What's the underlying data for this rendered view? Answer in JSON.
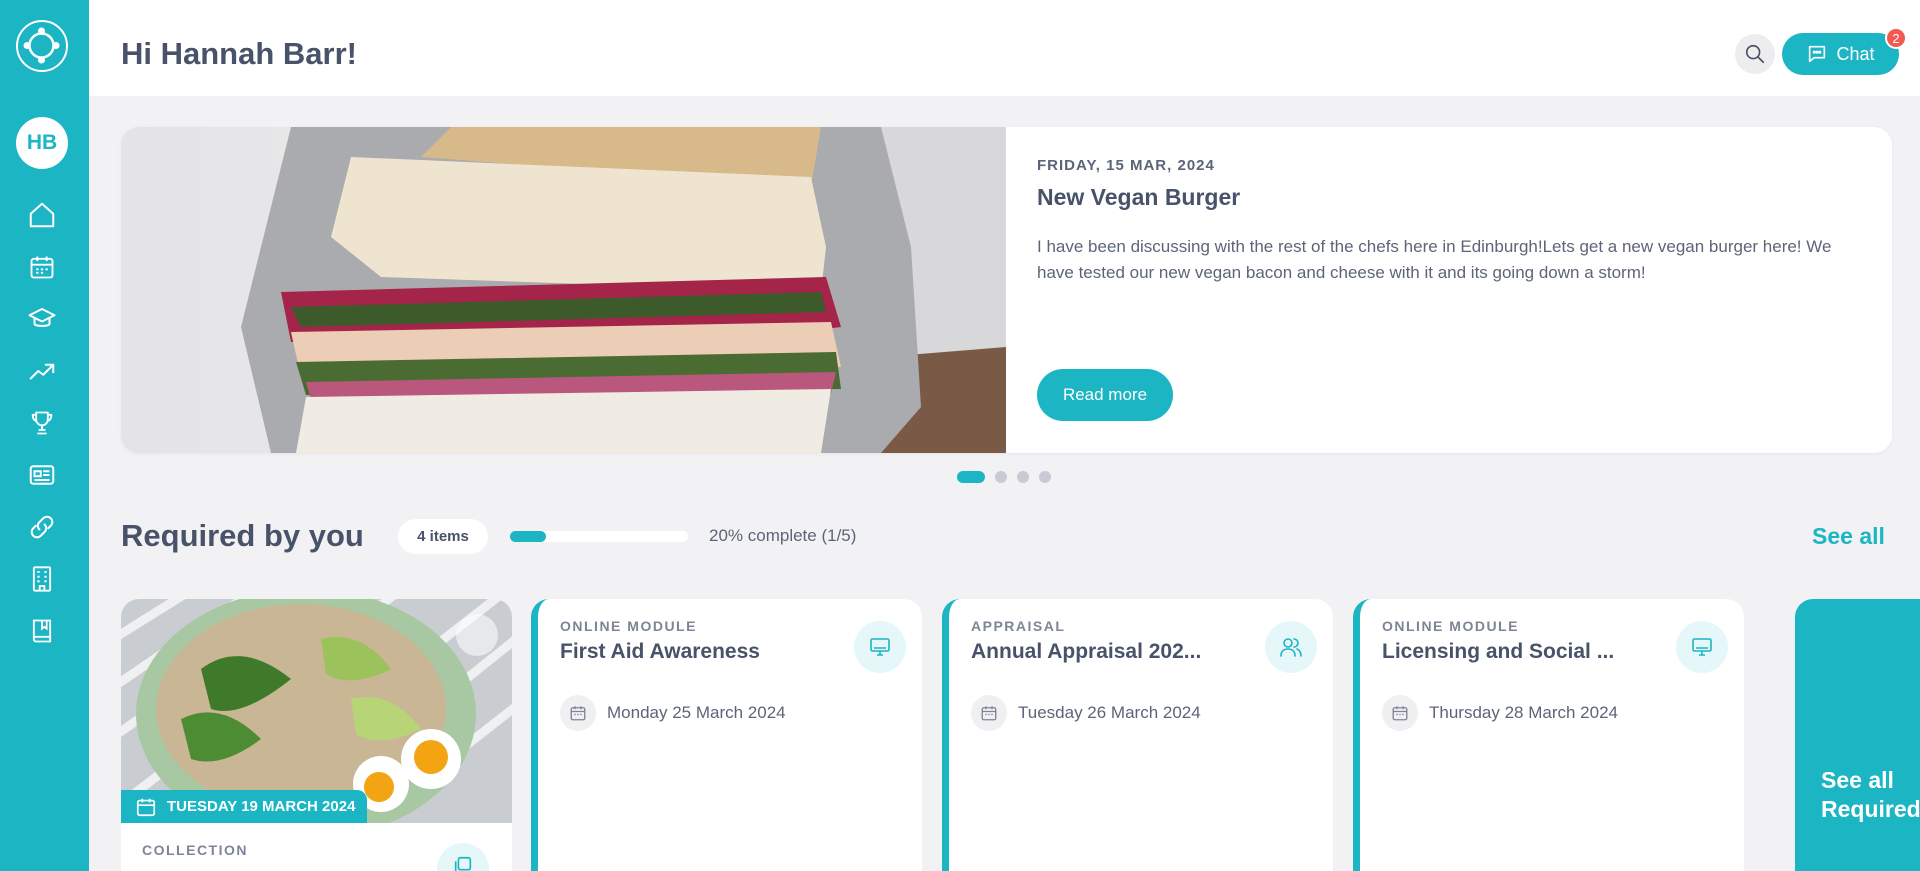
{
  "sidebar": {
    "avatar_initials": "HB",
    "nav_icons": [
      "home-icon",
      "calendar-icon",
      "graduation-cap-icon",
      "trending-up-icon",
      "trophy-icon",
      "newspaper-icon",
      "link-icon",
      "building-icon",
      "book-icon"
    ]
  },
  "header": {
    "greeting": "Hi Hannah Barr!",
    "chat_label": "Chat",
    "chat_badge": "2"
  },
  "hero": {
    "date": "FRIDAY, 15 MAR, 2024",
    "title": "New Vegan Burger",
    "body": "I have been discussing with the rest of the chefs here in Edinburgh!Lets get a new vegan burger here! We have tested our new vegan bacon and cheese with it and its going down a storm!",
    "button_label": "Read more",
    "slide_count": 4,
    "active_slide": 1
  },
  "required": {
    "title": "Required by you",
    "items_pill": "4 items",
    "progress_fraction": 0.2,
    "progress_text": "20% complete (1/5)",
    "see_all_label": "See all"
  },
  "cards": {
    "collection": {
      "date_tag": "TUESDAY 19 MARCH 2024",
      "type": "COLLECTION"
    },
    "modules": [
      {
        "type": "ONLINE MODULE",
        "title": "First Aid Awareness",
        "date": "Monday 25 March 2024",
        "icon": "monitor-icon"
      },
      {
        "type": "APPRAISAL",
        "title": "Annual Appraisal 202...",
        "date": "Tuesday 26 March 2024",
        "icon": "users-icon"
      },
      {
        "type": "ONLINE MODULE",
        "title": "Licensing and Social ...",
        "date": "Thursday 28 March 2024",
        "icon": "monitor-icon"
      }
    ],
    "see_all_card": {
      "line1": "See all",
      "line2": "Required"
    }
  },
  "colors": {
    "accent": "#1bb5c4",
    "badge": "#f05a50",
    "text": "#48536a",
    "background": "#f2f2f5"
  }
}
